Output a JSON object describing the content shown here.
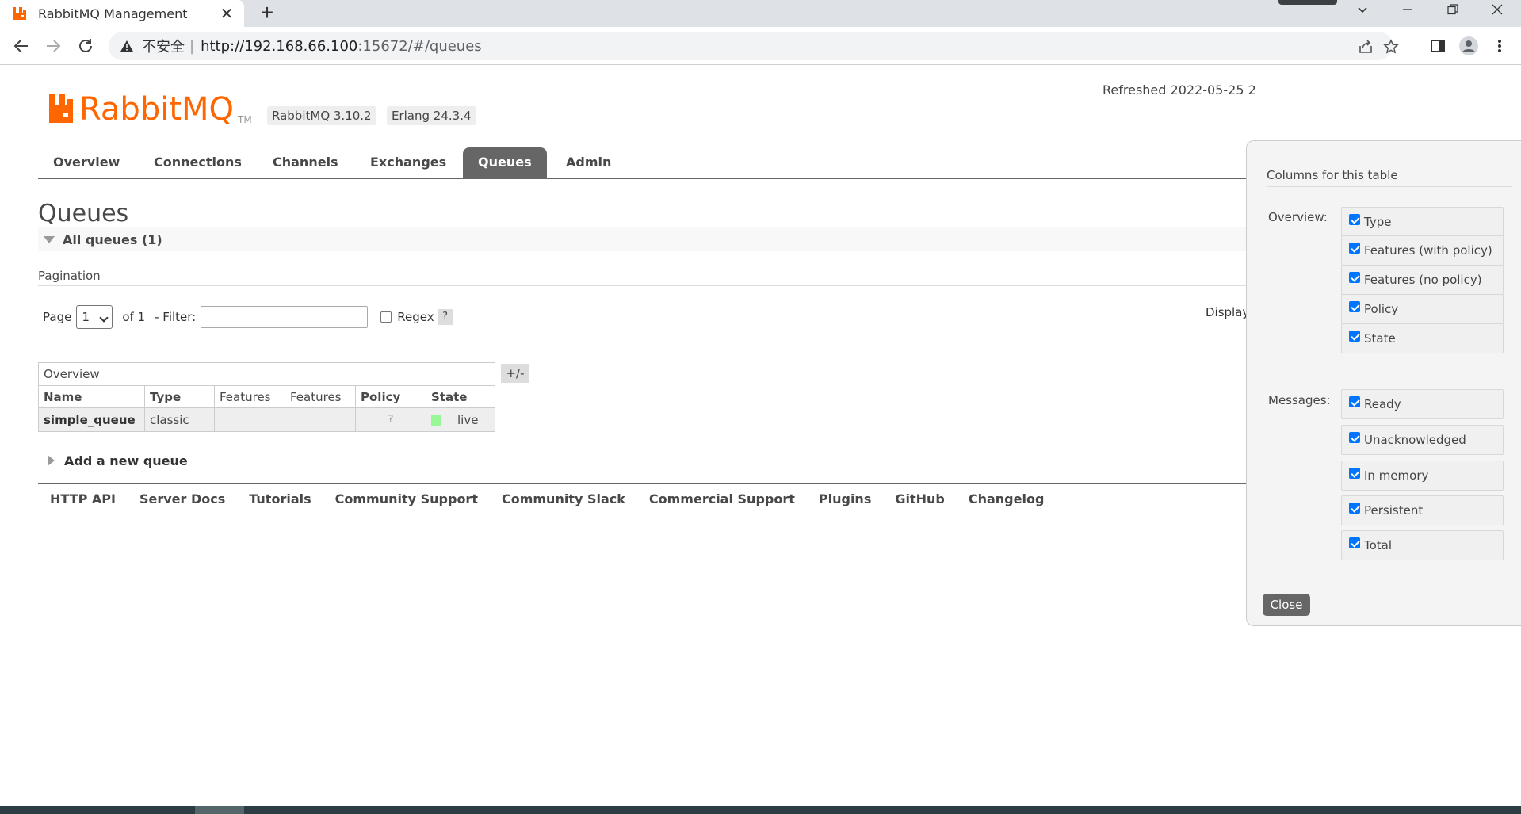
{
  "browser": {
    "tab_title": "RabbitMQ Management",
    "tab_close": "✕",
    "new_tab": "+",
    "security_label": "不安全",
    "separator": "|",
    "url_host": "http://192.168.66.100",
    "url_rest": ":15672/#/queues"
  },
  "header": {
    "logo_text": "RabbitMQ",
    "logo_tm": "TM",
    "rabbitmq_version": "RabbitMQ 3.10.2",
    "erlang_version": "Erlang 24.3.4",
    "refreshed": "Refreshed 2022-05-25 2"
  },
  "nav": {
    "tabs": [
      {
        "label": "Overview"
      },
      {
        "label": "Connections"
      },
      {
        "label": "Channels"
      },
      {
        "label": "Exchanges"
      },
      {
        "label": "Queues",
        "active": true
      },
      {
        "label": "Admin"
      }
    ]
  },
  "main": {
    "title": "Queues",
    "section_title": "All queues (1)",
    "pagination_label": "Pagination",
    "page_label": "Page",
    "page_value": "1",
    "of_label": "of 1",
    "filter_label": "- Filter:",
    "filter_value": "",
    "regex_label": "Regex",
    "help": "?",
    "display_label": "Display",
    "plus_minus": "+/-",
    "add_queue": "Add a new queue"
  },
  "table": {
    "group_header": "Overview",
    "columns": [
      "Name",
      "Type",
      "Features",
      "Features",
      "Policy",
      "State"
    ],
    "rows": [
      {
        "name": "simple_queue",
        "type": "classic",
        "features_policy": "",
        "features_no_policy": "",
        "policy": "?",
        "state": "live"
      }
    ]
  },
  "footer": {
    "links": [
      "HTTP API",
      "Server Docs",
      "Tutorials",
      "Community Support",
      "Community Slack",
      "Commercial Support",
      "Plugins",
      "GitHub",
      "Changelog"
    ]
  },
  "popup": {
    "title": "Columns for this table",
    "overview_label": "Overview:",
    "messages_label": "Messages:",
    "overview_options": [
      "Type",
      "Features (with policy)",
      "Features (no policy)",
      "Policy",
      "State"
    ],
    "messages_options": [
      "Ready",
      "Unacknowledged",
      "In memory",
      "Persistent",
      "Total"
    ],
    "close_label": "Close"
  },
  "colors": {
    "accent_orange": "#ff6600",
    "nav_active": "#666666",
    "live_green": "#98f898"
  }
}
